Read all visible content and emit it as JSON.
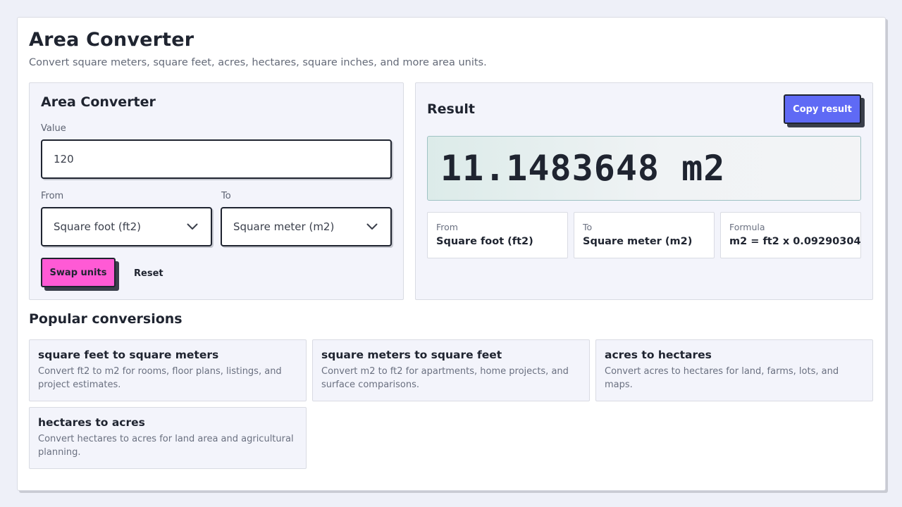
{
  "header": {
    "title": "Area Converter",
    "subtitle": "Convert square meters, square feet, acres, hectares, square inches, and more area units."
  },
  "converter": {
    "title": "Area Converter",
    "value_label": "Value",
    "value": "120",
    "from_label": "From",
    "from_selected": "Square foot (ft2)",
    "to_label": "To",
    "to_selected": "Square meter (m2)",
    "swap_label": "Swap units",
    "reset_label": "Reset"
  },
  "result": {
    "title": "Result",
    "copy_label": "Copy result",
    "value": "11.1483648 m2",
    "cards": [
      {
        "label": "From",
        "value": "Square foot (ft2)"
      },
      {
        "label": "To",
        "value": "Square meter (m2)"
      },
      {
        "label": "Formula",
        "value": "m2 = ft2 x 0.09290304"
      }
    ]
  },
  "popular": {
    "title": "Popular conversions",
    "items": [
      {
        "title": "square feet to square meters",
        "desc": "Convert ft2 to m2 for rooms, floor plans, listings, and project estimates."
      },
      {
        "title": "square meters to square feet",
        "desc": "Convert m2 to ft2 for apartments, home projects, and surface comparisons."
      },
      {
        "title": "acres to hectares",
        "desc": "Convert acres to hectares for land, farms, lots, and maps."
      },
      {
        "title": "hectares to acres",
        "desc": "Convert hectares to acres for land area and agricultural planning."
      }
    ]
  },
  "colors": {
    "swap_button": "#ff5ad5",
    "copy_button": "#5f6af5",
    "page_background": "#eef0f8"
  },
  "icons": {
    "select_arrow": "chevron-down-icon"
  }
}
